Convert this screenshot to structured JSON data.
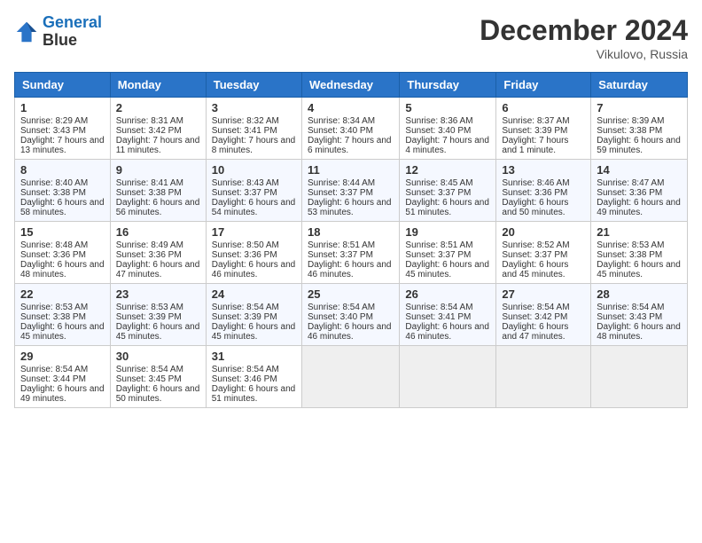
{
  "header": {
    "logo_line1": "General",
    "logo_line2": "Blue",
    "month": "December 2024",
    "location": "Vikulovo, Russia"
  },
  "weekdays": [
    "Sunday",
    "Monday",
    "Tuesday",
    "Wednesday",
    "Thursday",
    "Friday",
    "Saturday"
  ],
  "weeks": [
    [
      {
        "day": "1",
        "sunrise": "8:29 AM",
        "sunset": "3:43 PM",
        "daylight": "7 hours and 13 minutes."
      },
      {
        "day": "2",
        "sunrise": "8:31 AM",
        "sunset": "3:42 PM",
        "daylight": "7 hours and 11 minutes."
      },
      {
        "day": "3",
        "sunrise": "8:32 AM",
        "sunset": "3:41 PM",
        "daylight": "7 hours and 8 minutes."
      },
      {
        "day": "4",
        "sunrise": "8:34 AM",
        "sunset": "3:40 PM",
        "daylight": "7 hours and 6 minutes."
      },
      {
        "day": "5",
        "sunrise": "8:36 AM",
        "sunset": "3:40 PM",
        "daylight": "7 hours and 4 minutes."
      },
      {
        "day": "6",
        "sunrise": "8:37 AM",
        "sunset": "3:39 PM",
        "daylight": "7 hours and 1 minute."
      },
      {
        "day": "7",
        "sunrise": "8:39 AM",
        "sunset": "3:38 PM",
        "daylight": "6 hours and 59 minutes."
      }
    ],
    [
      {
        "day": "8",
        "sunrise": "8:40 AM",
        "sunset": "3:38 PM",
        "daylight": "6 hours and 58 minutes."
      },
      {
        "day": "9",
        "sunrise": "8:41 AM",
        "sunset": "3:38 PM",
        "daylight": "6 hours and 56 minutes."
      },
      {
        "day": "10",
        "sunrise": "8:43 AM",
        "sunset": "3:37 PM",
        "daylight": "6 hours and 54 minutes."
      },
      {
        "day": "11",
        "sunrise": "8:44 AM",
        "sunset": "3:37 PM",
        "daylight": "6 hours and 53 minutes."
      },
      {
        "day": "12",
        "sunrise": "8:45 AM",
        "sunset": "3:37 PM",
        "daylight": "6 hours and 51 minutes."
      },
      {
        "day": "13",
        "sunrise": "8:46 AM",
        "sunset": "3:36 PM",
        "daylight": "6 hours and 50 minutes."
      },
      {
        "day": "14",
        "sunrise": "8:47 AM",
        "sunset": "3:36 PM",
        "daylight": "6 hours and 49 minutes."
      }
    ],
    [
      {
        "day": "15",
        "sunrise": "8:48 AM",
        "sunset": "3:36 PM",
        "daylight": "6 hours and 48 minutes."
      },
      {
        "day": "16",
        "sunrise": "8:49 AM",
        "sunset": "3:36 PM",
        "daylight": "6 hours and 47 minutes."
      },
      {
        "day": "17",
        "sunrise": "8:50 AM",
        "sunset": "3:36 PM",
        "daylight": "6 hours and 46 minutes."
      },
      {
        "day": "18",
        "sunrise": "8:51 AM",
        "sunset": "3:37 PM",
        "daylight": "6 hours and 46 minutes."
      },
      {
        "day": "19",
        "sunrise": "8:51 AM",
        "sunset": "3:37 PM",
        "daylight": "6 hours and 45 minutes."
      },
      {
        "day": "20",
        "sunrise": "8:52 AM",
        "sunset": "3:37 PM",
        "daylight": "6 hours and 45 minutes."
      },
      {
        "day": "21",
        "sunrise": "8:53 AM",
        "sunset": "3:38 PM",
        "daylight": "6 hours and 45 minutes."
      }
    ],
    [
      {
        "day": "22",
        "sunrise": "8:53 AM",
        "sunset": "3:38 PM",
        "daylight": "6 hours and 45 minutes."
      },
      {
        "day": "23",
        "sunrise": "8:53 AM",
        "sunset": "3:39 PM",
        "daylight": "6 hours and 45 minutes."
      },
      {
        "day": "24",
        "sunrise": "8:54 AM",
        "sunset": "3:39 PM",
        "daylight": "6 hours and 45 minutes."
      },
      {
        "day": "25",
        "sunrise": "8:54 AM",
        "sunset": "3:40 PM",
        "daylight": "6 hours and 46 minutes."
      },
      {
        "day": "26",
        "sunrise": "8:54 AM",
        "sunset": "3:41 PM",
        "daylight": "6 hours and 46 minutes."
      },
      {
        "day": "27",
        "sunrise": "8:54 AM",
        "sunset": "3:42 PM",
        "daylight": "6 hours and 47 minutes."
      },
      {
        "day": "28",
        "sunrise": "8:54 AM",
        "sunset": "3:43 PM",
        "daylight": "6 hours and 48 minutes."
      }
    ],
    [
      {
        "day": "29",
        "sunrise": "8:54 AM",
        "sunset": "3:44 PM",
        "daylight": "6 hours and 49 minutes."
      },
      {
        "day": "30",
        "sunrise": "8:54 AM",
        "sunset": "3:45 PM",
        "daylight": "6 hours and 50 minutes."
      },
      {
        "day": "31",
        "sunrise": "8:54 AM",
        "sunset": "3:46 PM",
        "daylight": "6 hours and 51 minutes."
      },
      null,
      null,
      null,
      null
    ]
  ]
}
